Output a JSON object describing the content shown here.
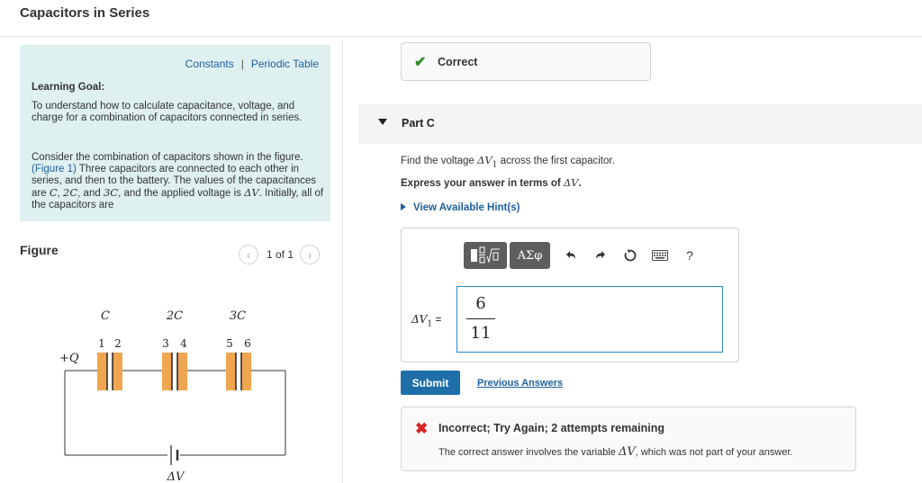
{
  "page": {
    "title": "Capacitors in Series"
  },
  "intro": {
    "constants_link": "Constants",
    "separator": "|",
    "periodic_link": "Periodic Table",
    "learning_goal_label": "Learning Goal:",
    "goal_text": "To understand how to calculate capacitance, voltage, and charge for a combination of capacitors connected in series.",
    "p2_before_link": "Consider the combination of capacitors shown in the figure.",
    "figure_link": "(Figure 1)",
    "p2_mid": " Three capacitors are connected to each other in series, and then to the battery. The values of the capacitances are ",
    "p2_C": "C",
    "p2_2C": "2C",
    "p2_3C": "3C",
    "p2_and_applied": ", and the applied voltage is ",
    "p2_dV": "ΔV",
    "p2_end": ". Initially, all of the capacitors are"
  },
  "figure": {
    "heading": "Figure",
    "pager": "1 of 1",
    "labels": {
      "c1": "C",
      "c2": "2C",
      "c3": "3C",
      "charge": "+Q",
      "battery": "ΔV"
    },
    "plates": [
      "1",
      "2",
      "3",
      "4",
      "5",
      "6"
    ]
  },
  "feedback_top": {
    "text": "Correct"
  },
  "part": {
    "label": "Part C"
  },
  "question": {
    "line1_prefix": "Find the voltage ",
    "line1_var": "ΔV",
    "line1_sub": "1",
    "line1_suffix": " across the first capacitor.",
    "line2_prefix": "Express your answer in terms of ",
    "line2_var": "ΔV",
    "line2_suffix": ".",
    "hints": "View Available Hint(s)"
  },
  "editor": {
    "toolbar": {
      "templates_icon": "fraction-root-icon",
      "greek": "ΑΣφ",
      "help": "?"
    },
    "var_label": "ΔV",
    "var_sub": "1",
    "equals": " =",
    "answer_numerator": "6",
    "answer_denominator": "11"
  },
  "actions": {
    "submit": "Submit",
    "previous": "Previous Answers"
  },
  "feedback_bottom": {
    "title": "Incorrect; Try Again; 2 attempts remaining",
    "message_prefix": "The correct answer involves the variable ",
    "message_var": "ΔV",
    "message_suffix": ", which was not part of your answer."
  }
}
